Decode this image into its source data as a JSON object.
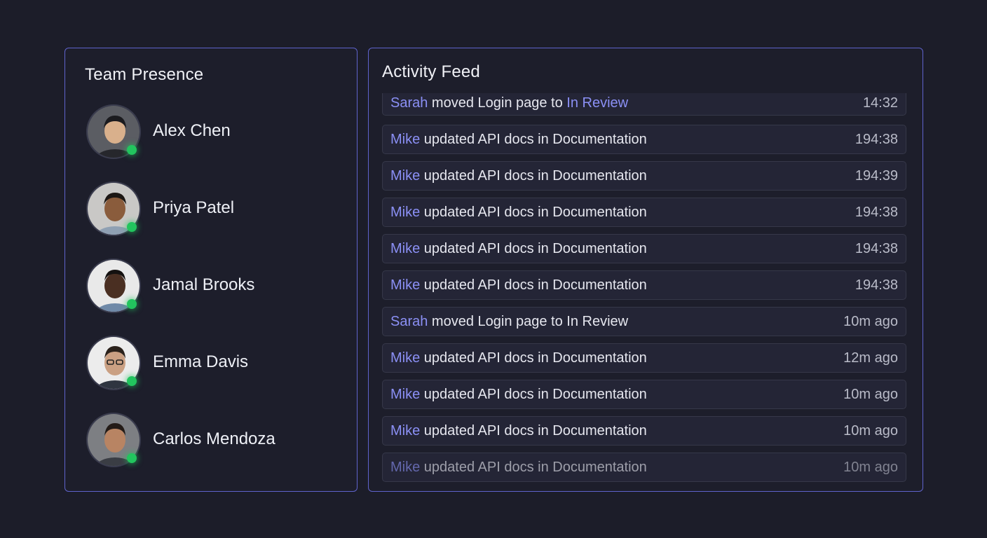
{
  "presence": {
    "title": "Team Presence",
    "status_color": "#22c55e",
    "members": [
      {
        "name": "Alex Chen",
        "status": "online"
      },
      {
        "name": "Priya Patel",
        "status": "online"
      },
      {
        "name": "Jamal Brooks",
        "status": "online"
      },
      {
        "name": "Emma Davis",
        "status": "online"
      },
      {
        "name": "Carlos Mendoza",
        "status": "online"
      }
    ]
  },
  "feed": {
    "title": "Activity Feed",
    "accent_color": "#8b90f5",
    "items": [
      {
        "actor": "Sarah",
        "action": " moved Login page to ",
        "target": "In Review",
        "time": "14:32"
      },
      {
        "actor": "Mike",
        "action": " updated API docs in Documentation",
        "time": "194:38"
      },
      {
        "actor": "Mike",
        "action": " updated API docs in Documentation",
        "time": "194:39"
      },
      {
        "actor": "Mike",
        "action": " updated API docs in Documentation",
        "time": "194:38"
      },
      {
        "actor": "Mike",
        "action": " updated API docs in Documentation",
        "time": "194:38"
      },
      {
        "actor": "Mike",
        "action": " updated API docs in Documentation",
        "time": "194:38"
      },
      {
        "actor": "Sarah",
        "action": " moved Login page to In Review",
        "time": "10m ago"
      },
      {
        "actor": "Mike",
        "action": " updated API docs in Documentation",
        "time": "12m ago"
      },
      {
        "actor": "Mike",
        "action": " updated API docs in Documentation",
        "time": "10m ago"
      },
      {
        "actor": "Mike",
        "action": " updated API docs in Documentation",
        "time": "10m ago"
      },
      {
        "actor": "Mike",
        "action": " updated API docs in Documentation",
        "time": "10m ago"
      }
    ]
  }
}
